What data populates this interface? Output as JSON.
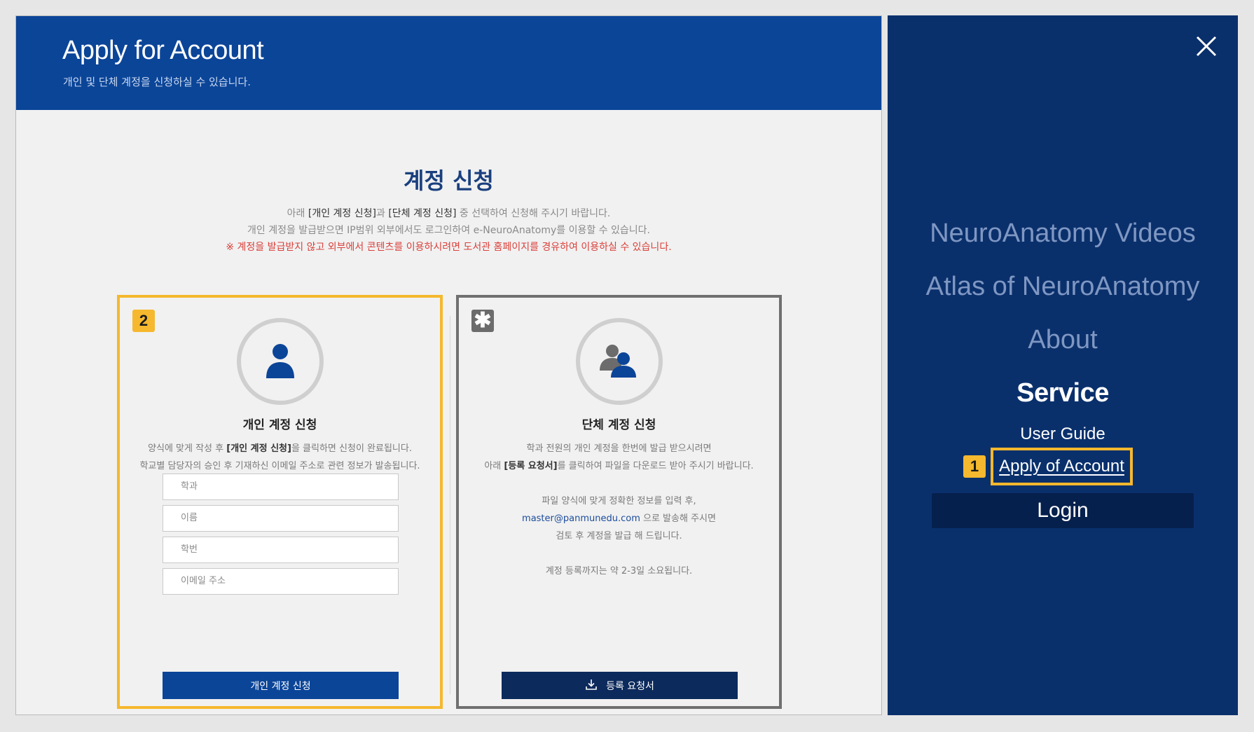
{
  "header": {
    "title": "Apply for Account",
    "subtitle": "개인 및 단체 계정을 신청하실 수 있습니다."
  },
  "section": {
    "title": "계정 신청",
    "intro_prefix": "아래 ",
    "intro_personal": "[개인 계정 신청]",
    "intro_mid": "과 ",
    "intro_group": "[단체 계정 신청]",
    "intro_suffix": " 중 선택하여 신청해 주시기 바랍니다.",
    "intro_line2": "개인 계정을 발급받으면 IP범위 외부에서도 로그인하여 e-NeuroAnatomy를 이용할 수 있습니다.",
    "intro_notice": "※ 계정을 발급받지 않고 외부에서 콘텐츠를 이용하시려면 도서관 홈페이지를 경유하여 이용하실 수 있습니다."
  },
  "personal_card": {
    "badge": "2",
    "icon": "person-icon",
    "title": "개인 계정 신청",
    "desc1_prefix": "양식에 맞게 작성 후 ",
    "desc1_bold": "[개인 계정 신청]",
    "desc1_suffix": "을 클릭하면 신청이 완료됩니다.",
    "desc2": "학교별 담당자의 승인 후 기재하신 이메일 주소로 관련 정보가 발송됩니다.",
    "fields": {
      "department": "학과",
      "name": "이름",
      "student_id": "학번",
      "email": "이메일 주소"
    },
    "button_label": "개인 계정 신청"
  },
  "group_card": {
    "badge": "✱",
    "icon": "group-icon",
    "title": "단체 계정 신청",
    "desc1": "학과 전원의 개인 계정을 한번에 발급 받으시려면",
    "desc2_prefix": "아래 ",
    "desc2_bold": "[등록 요청서]",
    "desc2_suffix": "를 클릭하여 파일을 다운로드 받아 주시기 바랍니다.",
    "desc3": "파일 양식에 맞게 정확한 정보를 입력 후,",
    "email": "master@panmunedu.com",
    "desc4_suffix": " 으로 발송해 주시면",
    "desc5": "검토 후 계정을 발급 해 드립니다.",
    "desc6": "계정 등록까지는 약 2-3일 소요됩니다.",
    "button_icon": "download-icon",
    "button_label": "등록 요청서"
  },
  "nav": {
    "close_icon": "close-icon",
    "items": [
      {
        "label": "NeuroAnatomy Videos"
      },
      {
        "label": "Atlas of NeuroAnatomy"
      },
      {
        "label": "About"
      },
      {
        "label": "Service"
      }
    ],
    "sub_items": [
      {
        "label": "User Guide"
      },
      {
        "label": "Apply of Account"
      }
    ],
    "badge": "1",
    "login_label": "Login"
  },
  "colors": {
    "header_blue": "#0b4598",
    "nav_bg": "#0a306c",
    "highlight_yellow": "#f5b82e",
    "notice_red": "#d9403a"
  }
}
